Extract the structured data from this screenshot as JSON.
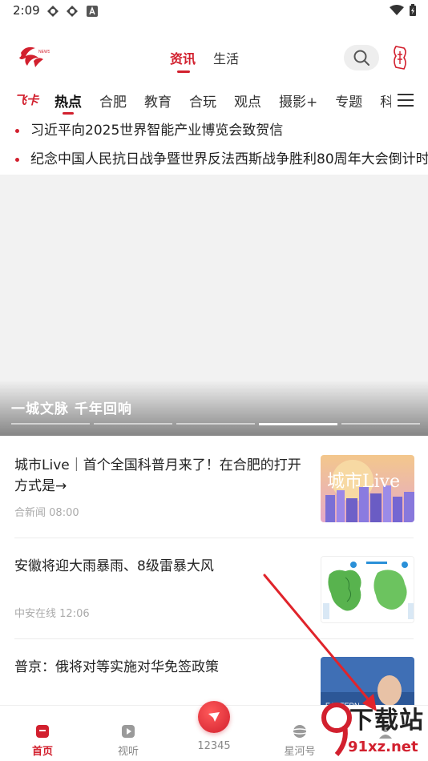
{
  "status_bar": {
    "time": "2:09",
    "icons": [
      "app-icon-a",
      "app-icon-b",
      "notification-a-icon"
    ],
    "right_icons": [
      "wifi-icon",
      "battery-icon"
    ]
  },
  "header": {
    "logo_icon": "hefei-news-logo",
    "tabs": [
      {
        "label": "资讯",
        "active": true
      },
      {
        "label": "生活",
        "active": false
      }
    ],
    "search_icon": "search-icon",
    "city_icon": "hefei-badge-icon"
  },
  "secondary_tabs": {
    "feika": "飞卡",
    "items": [
      {
        "label": "热点",
        "active": true
      },
      {
        "label": "合肥"
      },
      {
        "label": "教育"
      },
      {
        "label": "合玩"
      },
      {
        "label": "观点"
      },
      {
        "label": "摄影+"
      },
      {
        "label": "专题"
      },
      {
        "label": "科"
      }
    ],
    "menu_icon": "menu-icon"
  },
  "headlines": [
    "习近平向2025世界智能产业博览会致贺信",
    "纪念中国人民抗日战争暨世界反法西斯战争胜利80周年大会倒计时"
  ],
  "banner": {
    "caption": "一城文脉  千年回响",
    "indicator_count": 5,
    "active_index": 3
  },
  "news": [
    {
      "title": "城市Live｜首个全国科普月来了！在合肥的打开方式是→",
      "source": "合新闻",
      "time": "08:00",
      "thumb_text": "城市Live"
    },
    {
      "title": "安徽将迎大雨暴雨、8级雷暴大风",
      "source": "中安在线",
      "time": "12:06",
      "thumb_text": ""
    },
    {
      "title": "普京：俄将对等实施对华免签政策",
      "source": "",
      "time": "",
      "thumb_text": ""
    }
  ],
  "bottom_nav": [
    {
      "label": "首页",
      "icon": "home-icon",
      "active": true
    },
    {
      "label": "视听",
      "icon": "play-icon",
      "active": false
    },
    {
      "label": "12345",
      "icon": "hotline-icon",
      "active": false
    },
    {
      "label": "星河号",
      "icon": "planet-icon",
      "active": false
    },
    {
      "label": "",
      "icon": "profile-icon",
      "active": false
    }
  ],
  "watermark": {
    "line1": "下载站",
    "line2": "91xz.net"
  },
  "colors": {
    "accent": "#d2202e",
    "text": "#222222",
    "muted": "#aaaaaa",
    "arrow": "#e0242b"
  }
}
